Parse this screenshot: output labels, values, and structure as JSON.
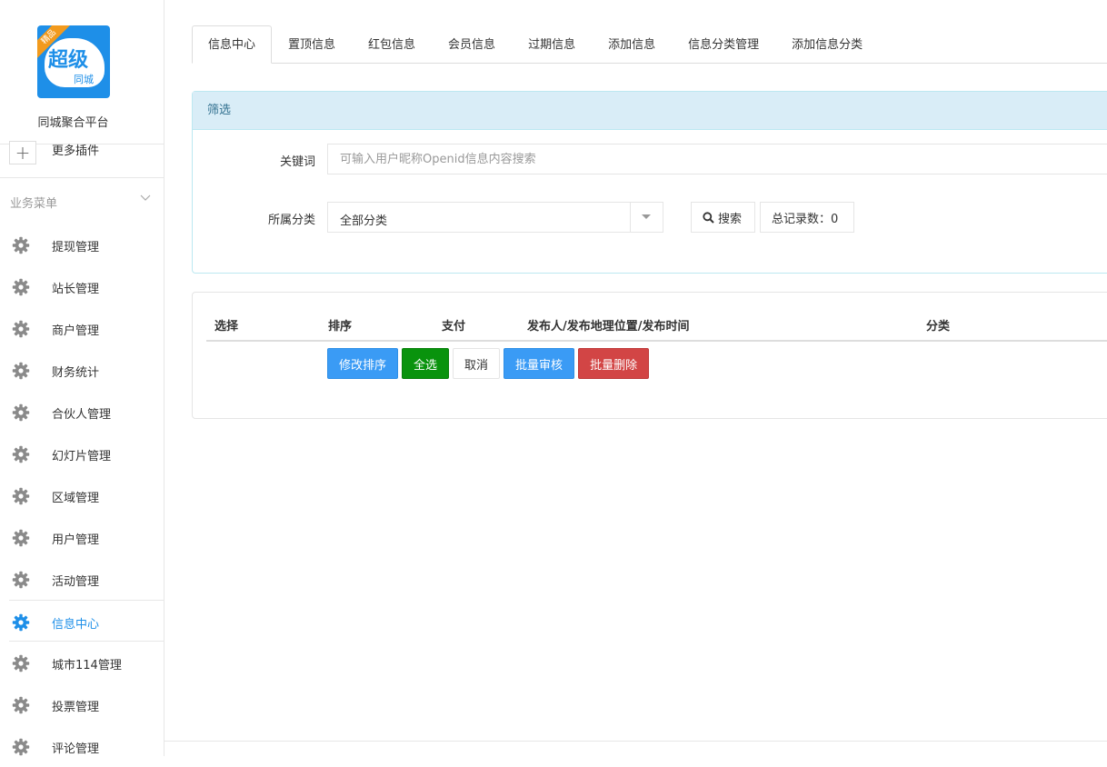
{
  "brand": {
    "logo_badge": "精品",
    "logo_big": "超级",
    "logo_small": "同城",
    "name": "同城聚合平台"
  },
  "sidebar": {
    "more_plugins": "更多插件",
    "group_title": "业务菜单",
    "items": [
      {
        "label": "提现管理",
        "icon": "gear-icon"
      },
      {
        "label": "站长管理",
        "icon": "gear-icon"
      },
      {
        "label": "商户管理",
        "icon": "gear-icon"
      },
      {
        "label": "财务统计",
        "icon": "gear-icon"
      },
      {
        "label": "合伙人管理",
        "icon": "gear-icon"
      },
      {
        "label": "幻灯片管理",
        "icon": "gear-icon"
      },
      {
        "label": "区域管理",
        "icon": "gear-icon"
      },
      {
        "label": "用户管理",
        "icon": "gear-icon"
      },
      {
        "label": "活动管理",
        "icon": "gear-icon"
      },
      {
        "label": "信息中心",
        "icon": "gear-icon",
        "active": true
      },
      {
        "label": "城市114管理",
        "icon": "gear-icon"
      },
      {
        "label": "投票管理",
        "icon": "gear-icon"
      },
      {
        "label": "评论管理",
        "icon": "gear-icon"
      }
    ]
  },
  "tabs": [
    "信息中心",
    "置顶信息",
    "红包信息",
    "会员信息",
    "过期信息",
    "添加信息",
    "信息分类管理",
    "添加信息分类"
  ],
  "filter": {
    "heading": "筛选",
    "keyword_label": "关键词",
    "keyword_placeholder": "可输入用户昵称Openid信息内容搜索",
    "keyword_value": "",
    "category_label": "所属分类",
    "category_value": "全部分类",
    "search_button": "搜索",
    "total_label": "总记录数：0"
  },
  "table": {
    "columns": [
      "选择",
      "排序",
      "支付",
      "发布人/发布地理位置/发布时间",
      "分类"
    ]
  },
  "actions": {
    "edit_sort": "修改排序",
    "select_all": "全选",
    "cancel": "取消",
    "batch_review": "批量审核",
    "batch_delete": "批量删除"
  },
  "colors": {
    "primary": "#3a9bf5",
    "success": "#09930d",
    "danger": "#d24545",
    "active_menu": "#1e8fe8",
    "panel_heading_bg": "#d9edf7"
  }
}
